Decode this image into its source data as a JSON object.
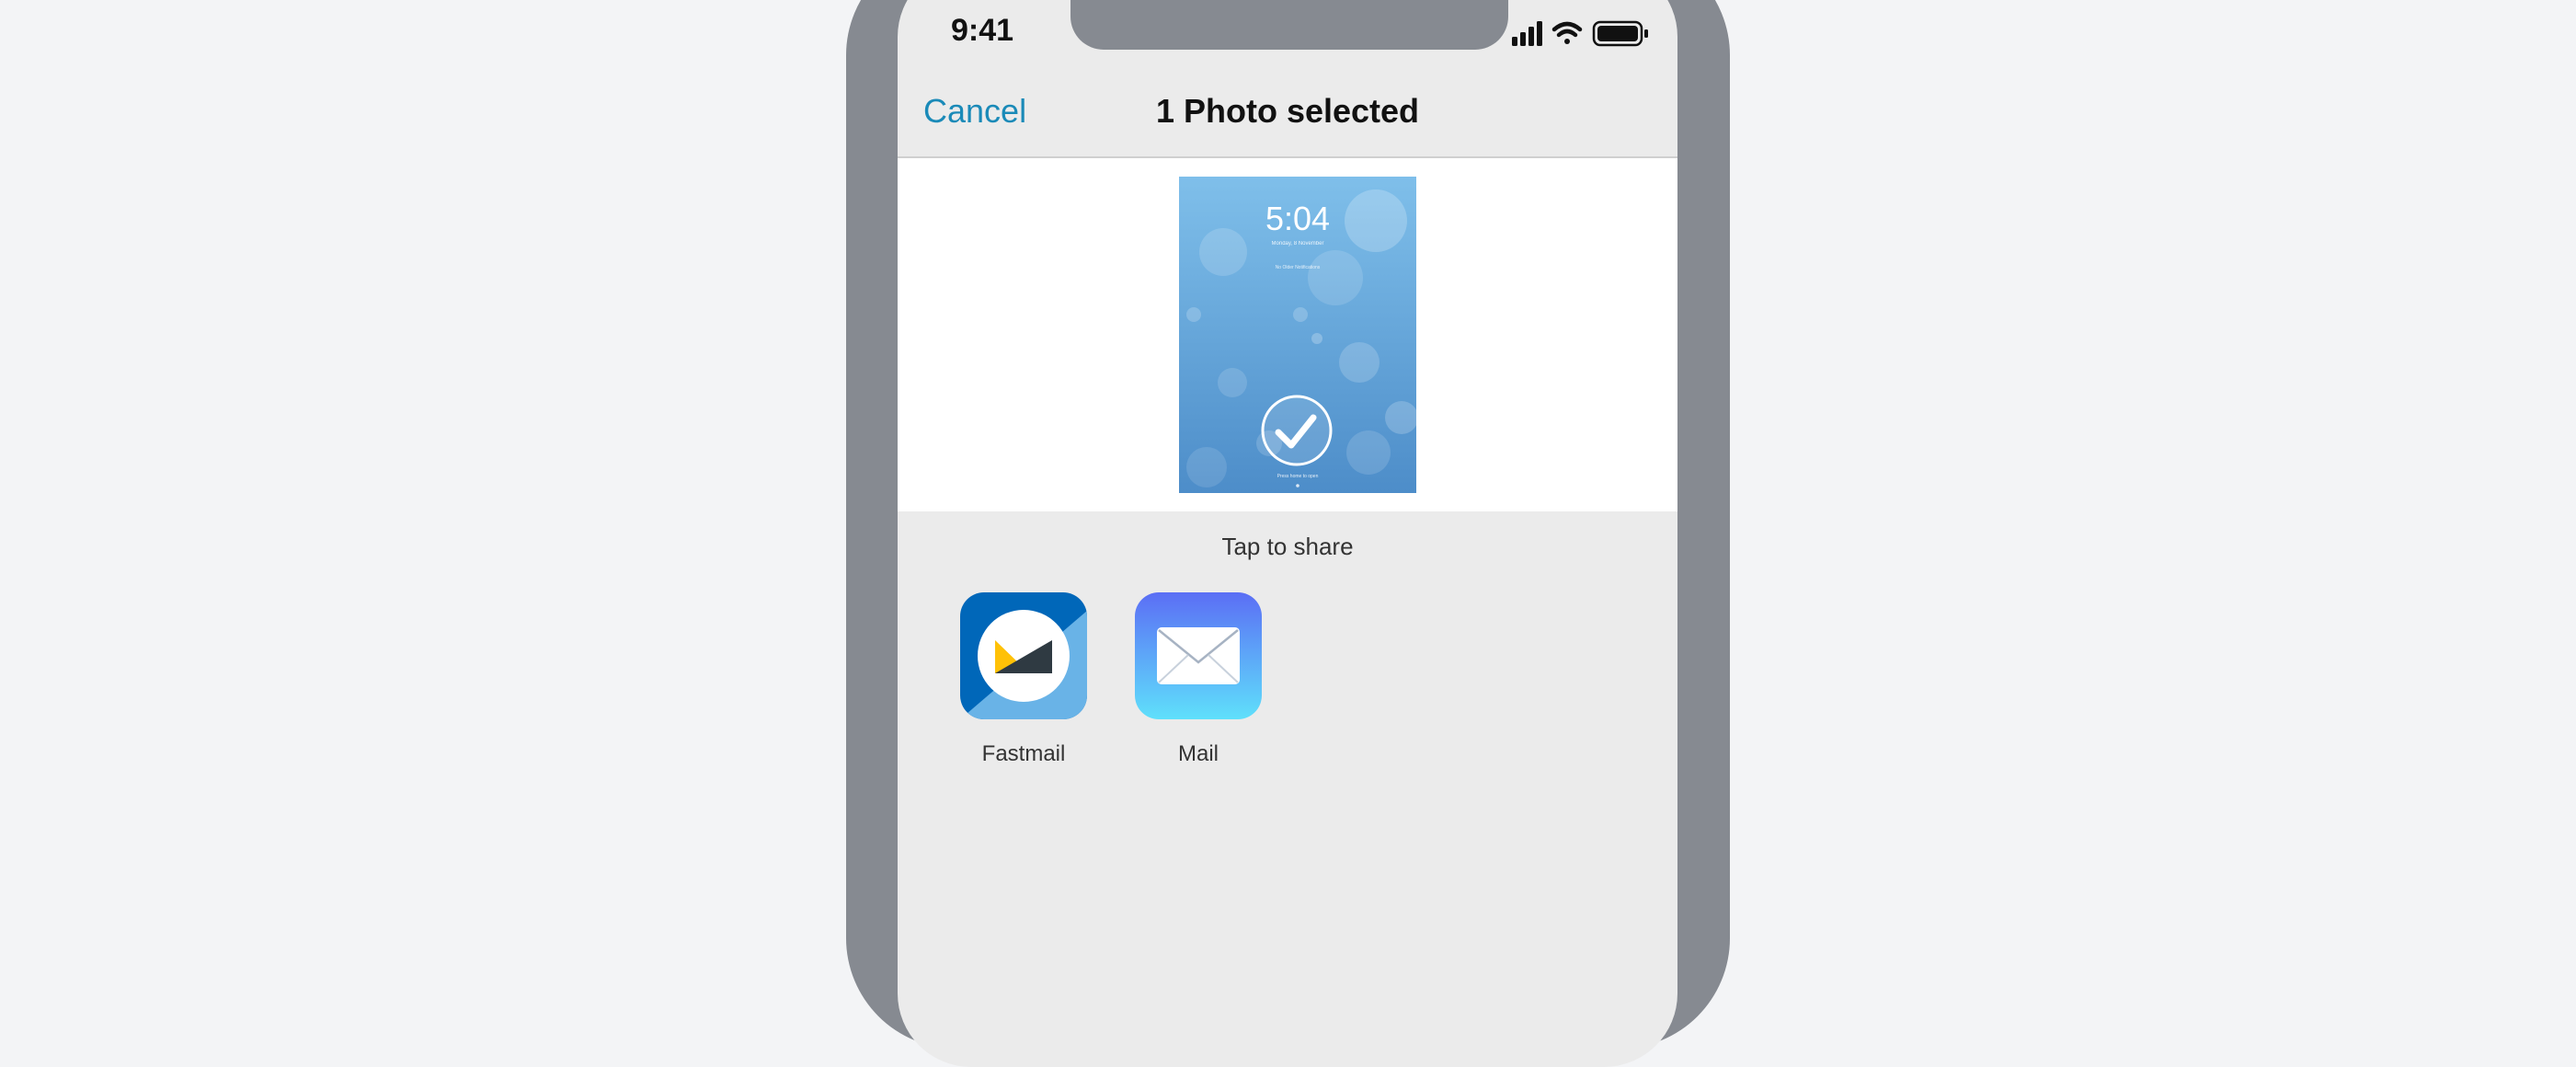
{
  "status_bar": {
    "time": "9:41",
    "icons": [
      "signal-icon",
      "wifi-icon",
      "battery-icon"
    ]
  },
  "nav": {
    "cancel_label": "Cancel",
    "title": "1 Photo selected"
  },
  "preview": {
    "lock_time": "5:04",
    "lock_date": "Monday, 8 November",
    "lock_notice": "No Older Notifications",
    "lock_hint": "Press home to open",
    "selected": true
  },
  "share": {
    "label": "Tap to share",
    "apps": [
      {
        "name": "Fastmail",
        "icon": "fastmail-icon"
      },
      {
        "name": "Mail",
        "icon": "mail-icon"
      }
    ]
  },
  "colors": {
    "accent": "#1a8ab8",
    "fastmail_dark": "#0067b9",
    "fastmail_light": "#69b3e7",
    "fastmail_yellow": "#ffc107",
    "mail_top": "#5b6ef5",
    "mail_bottom": "#5fe0fb"
  }
}
